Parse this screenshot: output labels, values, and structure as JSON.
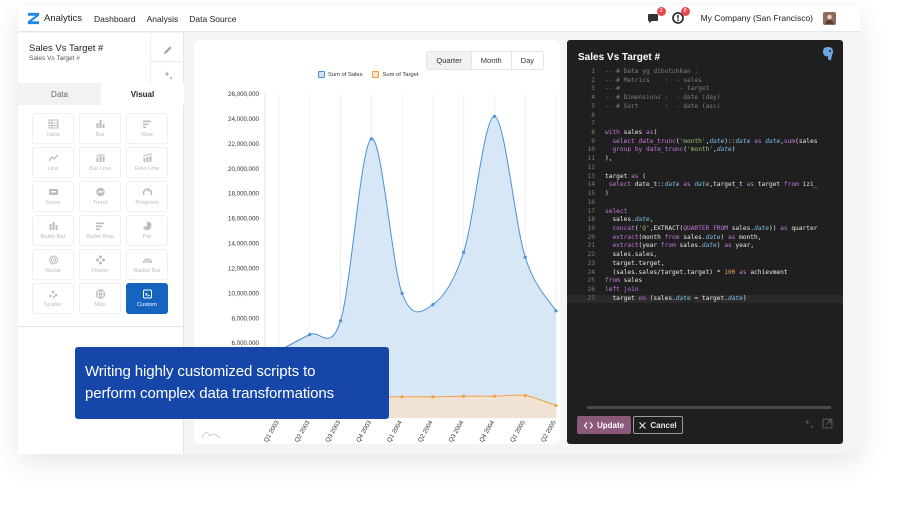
{
  "header": {
    "brand": "Analytics",
    "nav": [
      "Dashboard",
      "Analysis",
      "Data Source"
    ],
    "chat_badge": "3",
    "alert_badge": "8",
    "company": "My Company (San Francisco)"
  },
  "left_panel": {
    "chart_title": "Sales Vs Target #",
    "chart_subtitle": "Sales Vs Target #",
    "tabs": [
      "Data",
      "Visual"
    ],
    "active_tab": "Visual",
    "viz_types": [
      {
        "label": "Table",
        "icon": "table-icon"
      },
      {
        "label": "Bar",
        "icon": "bar-chart-icon"
      },
      {
        "label": "Row",
        "icon": "row-chart-icon"
      },
      {
        "label": "Line",
        "icon": "line-chart-icon"
      },
      {
        "label": "Bar Line",
        "icon": "bar-line-icon"
      },
      {
        "label": "Row Line",
        "icon": "row-line-icon"
      },
      {
        "label": "Score",
        "icon": "score-icon"
      },
      {
        "label": "Trend",
        "icon": "trend-icon"
      },
      {
        "label": "Progress",
        "icon": "progress-icon"
      },
      {
        "label": "Bullet Bar",
        "icon": "bullet-bar-icon"
      },
      {
        "label": "Bullet Row",
        "icon": "bullet-row-icon"
      },
      {
        "label": "Pie",
        "icon": "pie-icon"
      },
      {
        "label": "Radar",
        "icon": "radar-icon"
      },
      {
        "label": "Flower",
        "icon": "flower-icon"
      },
      {
        "label": "Radial Bar",
        "icon": "radial-bar-icon"
      },
      {
        "label": "Scatter",
        "icon": "scatter-icon"
      },
      {
        "label": "Map",
        "icon": "map-icon"
      },
      {
        "label": "Custom",
        "icon": "custom-icon"
      }
    ],
    "selected_viz": "Custom"
  },
  "chart_panel": {
    "period_options": [
      "Quarter",
      "Month",
      "Day"
    ],
    "selected_period": "Quarter"
  },
  "chart_data": {
    "type": "area",
    "categories": [
      "Q1 2003",
      "Q2 2003",
      "Q3 2003",
      "Q4 2003",
      "Q1 2004",
      "Q2 2004",
      "Q3 2004",
      "Q4 2004",
      "Q1 2005",
      "Q2 2005"
    ],
    "series": [
      {
        "name": "Sum of Sales",
        "color": "#4a90d9",
        "values": [
          5400000,
          6700000,
          7800000,
          22400000,
          10000000,
          9100000,
          13300000,
          24200000,
          12900000,
          8600000
        ]
      },
      {
        "name": "Sum of Target",
        "color": "#f0a040",
        "values": [
          2150000,
          1800000,
          1750000,
          1700000,
          1700000,
          1700000,
          1750000,
          1750000,
          1800000,
          1000000
        ]
      }
    ],
    "ylim": [
      0,
      26000000
    ],
    "ytick_labels": [
      "26,000,000",
      "24,000,000",
      "22,000,000",
      "20,000,000",
      "18,000,000",
      "16,000,000",
      "14,000,000",
      "12,000,000",
      "10,000,000",
      "8,000,000",
      "6,000,000"
    ],
    "legend_position": "top-center",
    "grid": "vertical"
  },
  "code_panel": {
    "title": "Sales Vs Target #",
    "lines": [
      {
        "n": "1",
        "t": "-- # Data yg dibutuhkan :"
      },
      {
        "n": "2",
        "t": "-- # Metrics    :  - sales"
      },
      {
        "n": "3",
        "t": "-- #                - target"
      },
      {
        "n": "4",
        "t": "-- # Dimensions :  - date (day)"
      },
      {
        "n": "5",
        "t": "-- # Sort       :  - date (asc)"
      },
      {
        "n": "6",
        "t": ""
      },
      {
        "n": "7",
        "t": ""
      },
      {
        "n": "8",
        "t": "with sales as("
      },
      {
        "n": "9",
        "t": "  select date_trunc('month',date)::date as date,sum(sales"
      },
      {
        "n": "10",
        "t": "  group by date_trunc('month',date)"
      },
      {
        "n": "11",
        "t": "),"
      },
      {
        "n": "12",
        "t": ""
      },
      {
        "n": "13",
        "t": "target as ("
      },
      {
        "n": "14",
        "t": " select date_t::date as date,target_t as target from izi_"
      },
      {
        "n": "15",
        "t": ")"
      },
      {
        "n": "16",
        "t": ""
      },
      {
        "n": "17",
        "t": "select"
      },
      {
        "n": "18",
        "t": "  sales.date,"
      },
      {
        "n": "19",
        "t": "  concat('Q',EXTRACT(QUARTER FROM sales.date)) as quarter"
      },
      {
        "n": "20",
        "t": "  extract(month from sales.date) as month,"
      },
      {
        "n": "21",
        "t": "  extract(year from sales.date) as year,"
      },
      {
        "n": "22",
        "t": "  sales.sales,"
      },
      {
        "n": "23",
        "t": "  target.target,"
      },
      {
        "n": "24",
        "t": "  (sales.sales/target.target) * 100 as achievment"
      },
      {
        "n": "25",
        "t": "from sales"
      },
      {
        "n": "26",
        "t": "left join"
      },
      {
        "n": "27",
        "t": "  target on (sales.date = target.date)"
      }
    ],
    "update_label": "Update",
    "cancel_label": "Cancel"
  },
  "callout": {
    "line1": "Writing highly customized scripts to",
    "line2": "perform complex data transformations"
  }
}
